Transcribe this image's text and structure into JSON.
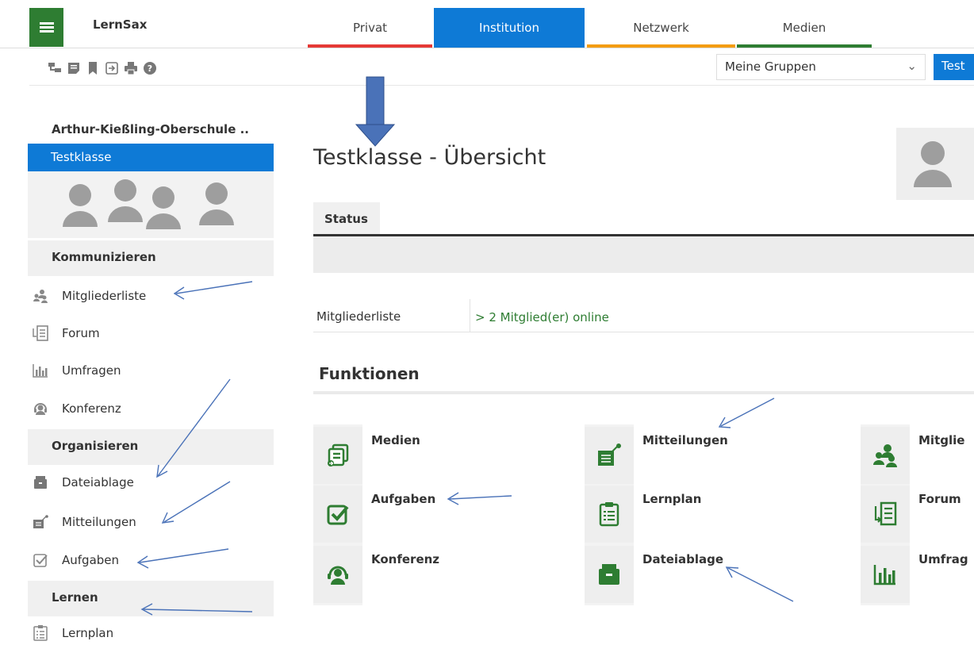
{
  "header": {
    "brand": "LernSax",
    "tabs": [
      {
        "label": "Privat",
        "color": "#e53935"
      },
      {
        "label": "Institution",
        "color": "#0e7ad6"
      },
      {
        "label": "Netzwerk",
        "color": "#f39c12"
      },
      {
        "label": "Medien",
        "color": "#2e7d32"
      }
    ],
    "active_tab": "Institution",
    "group_select": "Meine Gruppen",
    "action_button": "Test"
  },
  "sidebar": {
    "institution": "Arthur-Kießling-Oberschule ..",
    "selected": "Testklasse",
    "sections": [
      {
        "title": "Kommunizieren",
        "items": [
          "Mitgliederliste",
          "Forum",
          "Umfragen",
          "Konferenz"
        ]
      },
      {
        "title": "Organisieren",
        "items": [
          "Dateiablage",
          "Mitteilungen",
          "Aufgaben"
        ]
      },
      {
        "title": "Lernen",
        "items": [
          "Lernplan"
        ]
      }
    ]
  },
  "main": {
    "title": "Testklasse - Übersicht",
    "status_tab": "Status",
    "members_label": "Mitgliederliste",
    "members_online": "> 2 Mitglied(er) online",
    "functions_title": "Funktionen",
    "functions": [
      [
        "Medien",
        "Mitteilungen",
        "Mitglie"
      ],
      [
        "Aufgaben",
        "Lernplan",
        "Forum"
      ],
      [
        "Konferenz",
        "Dateiablage",
        "Umfrag"
      ]
    ]
  },
  "colors": {
    "accent_blue": "#0e7ad6",
    "accent_green": "#2e7d32",
    "annotation_arrow": "#4a72b8"
  }
}
